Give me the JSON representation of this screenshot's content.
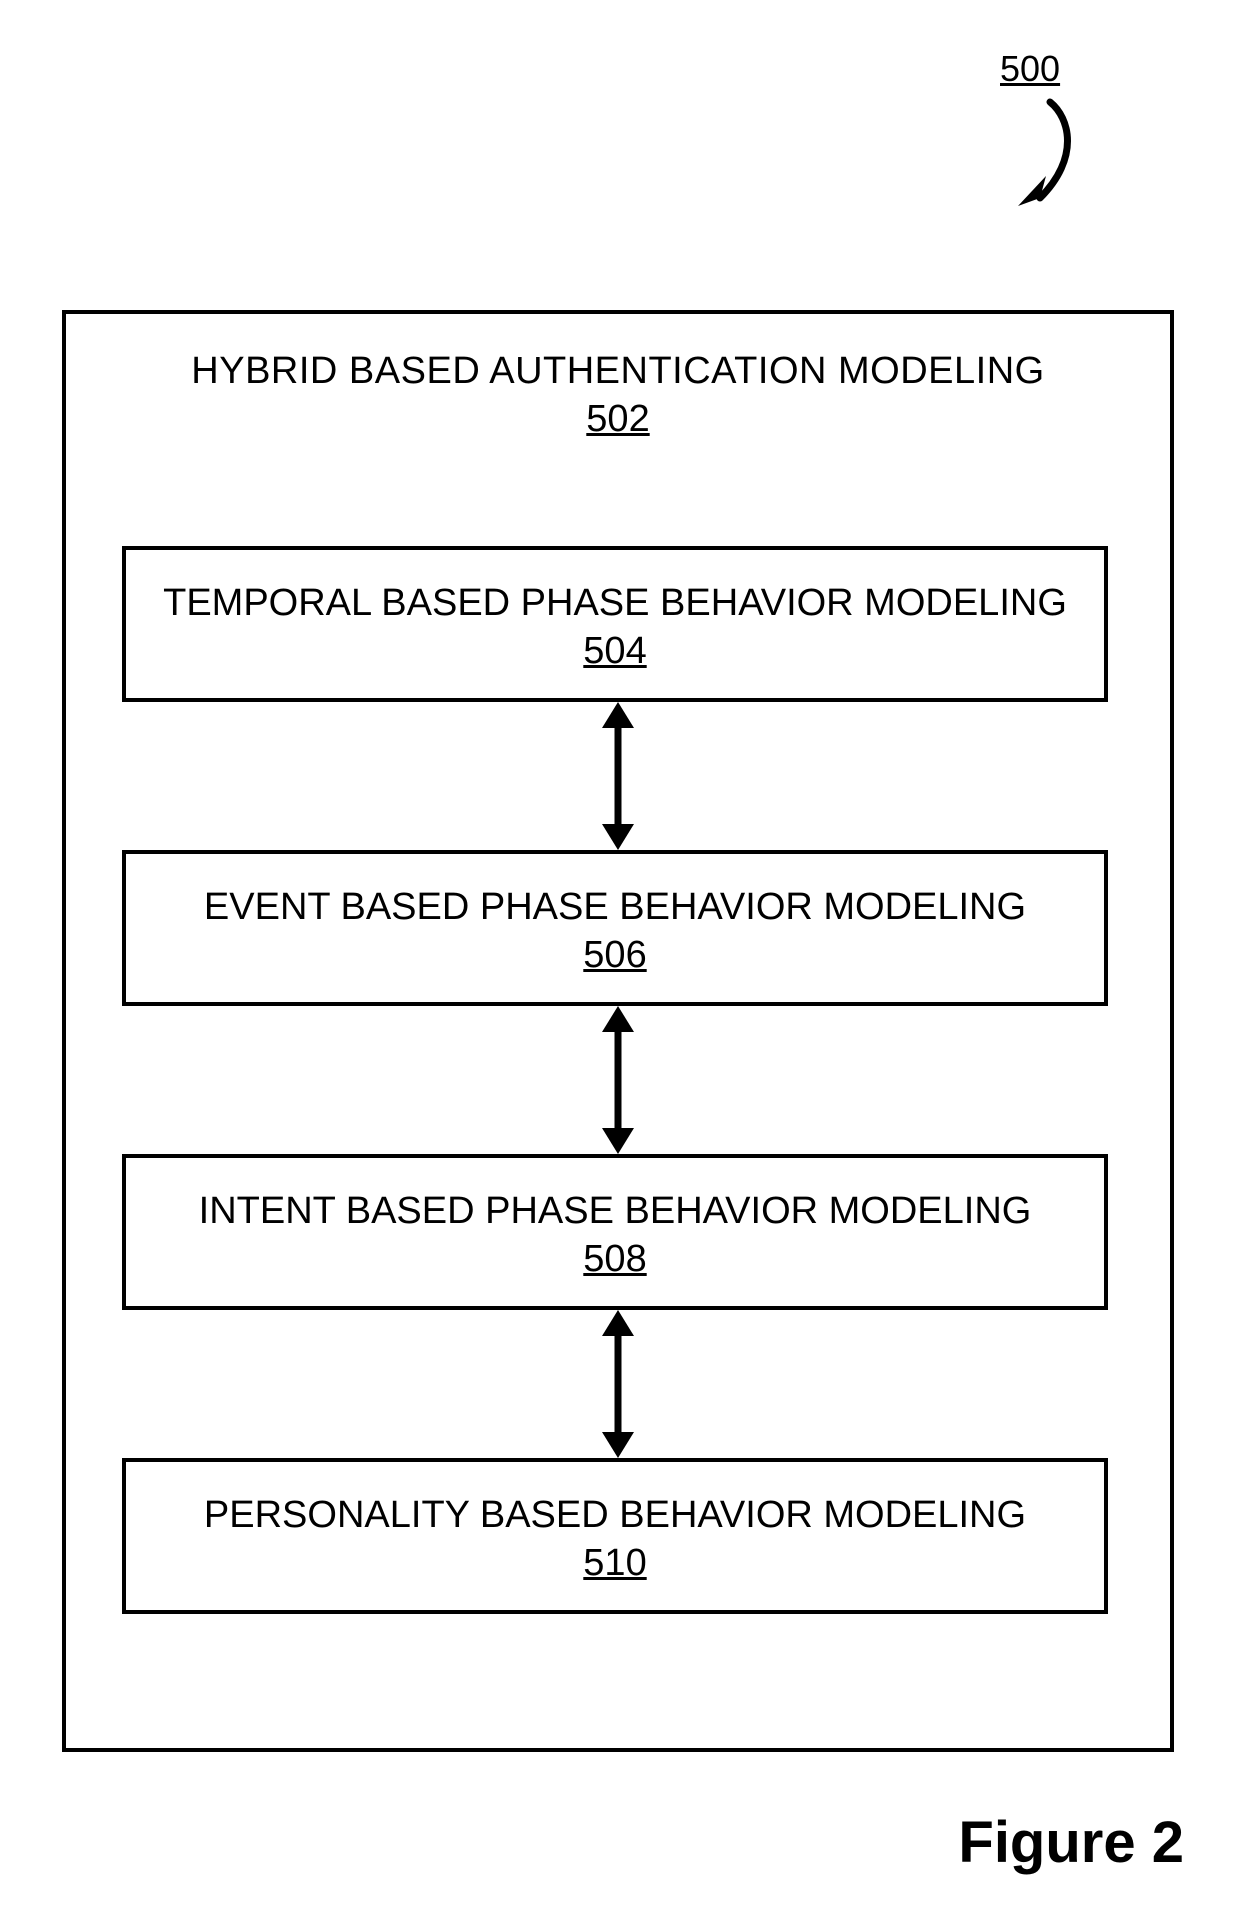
{
  "diagram": {
    "figure_ref": "500",
    "outer": {
      "title": "HYBRID BASED AUTHENTICATION MODELING",
      "ref": "502"
    },
    "boxes": [
      {
        "title": "TEMPORAL BASED PHASE BEHAVIOR MODELING",
        "ref": "504"
      },
      {
        "title": "EVENT BASED PHASE BEHAVIOR MODELING",
        "ref": "506"
      },
      {
        "title": "INTENT BASED PHASE BEHAVIOR MODELING",
        "ref": "508"
      },
      {
        "title": "PERSONALITY BASED BEHAVIOR MODELING",
        "ref": "510"
      }
    ],
    "caption": "Figure 2"
  }
}
